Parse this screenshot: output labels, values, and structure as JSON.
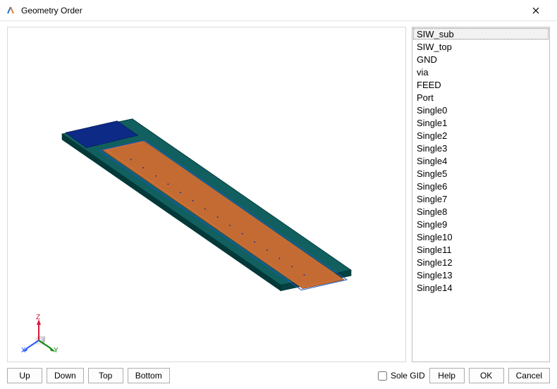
{
  "window": {
    "title": "Geometry Order"
  },
  "list": {
    "items": [
      "SIW_sub",
      "SIW_top",
      "GND",
      "via",
      "FEED",
      "Port",
      "Single0",
      "Single1",
      "Single2",
      "Single3",
      "Single4",
      "Single5",
      "Single6",
      "Single7",
      "Single8",
      "Single9",
      "Single10",
      "Single11",
      "Single12",
      "Single13",
      "Single14"
    ],
    "selected_index": 0
  },
  "axes": {
    "x": "X",
    "y": "Y",
    "z": "Z",
    "colors": {
      "x": "#2b5cff",
      "y": "#0a8a0a",
      "z": "#d8183a"
    }
  },
  "footer": {
    "left": {
      "up": "Up",
      "down": "Down",
      "top": "Top",
      "bottom": "Bottom"
    },
    "sole_gid": "Sole GID",
    "help": "Help",
    "ok": "OK",
    "cancel": "Cancel"
  },
  "model_colors": {
    "substrate": "#0f5a5a",
    "edge_dark": "#003a3a",
    "top_patch": "#c46b34",
    "top_patch_hi": "#d07d44",
    "feed": "#0c2a86",
    "trace": "#1a56c8",
    "via_dot": "#163a8c"
  }
}
